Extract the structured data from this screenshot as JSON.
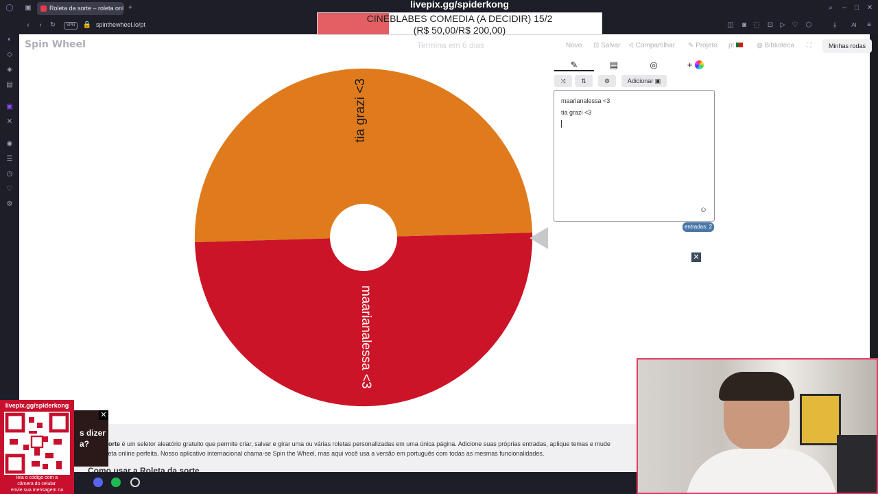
{
  "browser": {
    "tab_title": "Roleta da sorte – roleta onl",
    "url": "spinthewheel.io/pt",
    "vpn": "VPN"
  },
  "overlay": {
    "title": "livepix.gg/spiderkong",
    "line1": "CINEBLABES COMEDIA (A DECIDIR) 15/2",
    "line2": "(R$ 50,00/R$ 200,00)",
    "progress": 0.25,
    "progress_color": "#e2565b"
  },
  "site": {
    "logo": "Spin Wheel",
    "ends": "Termina em 6 dias",
    "nav": {
      "novo": "Novo",
      "salvar": "Salvar",
      "compartilhar": "Compartilhar",
      "projeto": "Projeto",
      "lang": "pt",
      "biblioteca": "Biblioteca",
      "minhas_rodas": "Minhas rodas"
    }
  },
  "wheel": {
    "segments": [
      {
        "label": "tia grazi <3",
        "color": "#e07b1d"
      },
      {
        "label": "maarianalessa <3",
        "color": "#cc1428"
      }
    ]
  },
  "editor": {
    "add_button": "Adicionar",
    "entries": [
      "maarianalessa <3",
      "tia grazi <3"
    ],
    "count_label": "entradas: 2"
  },
  "footer": {
    "line1_bold": "da sorte",
    "line1": " é um seletor aleatório gratuito que permite criar, salvar e girar uma ou várias roletas personalizadas em uma única página. Adicione suas próprias entradas, aplique temas e mude",
    "line2": "a roleta online perfeita. Nosso aplicativo internacional chama-se Spin the Wheel, mas aqui você usa a versão em português com todas as mesmas funcionalidades.",
    "line3": "Como usar a Roleta da sorte"
  },
  "qr": {
    "title": "livepix.gg/spiderkong",
    "foot1": "leia o código com a",
    "foot2": "câmera do celular.",
    "foot3": "envie sua mensagem na"
  },
  "promo": {
    "text1": "s dizer",
    "text2": "a?"
  }
}
